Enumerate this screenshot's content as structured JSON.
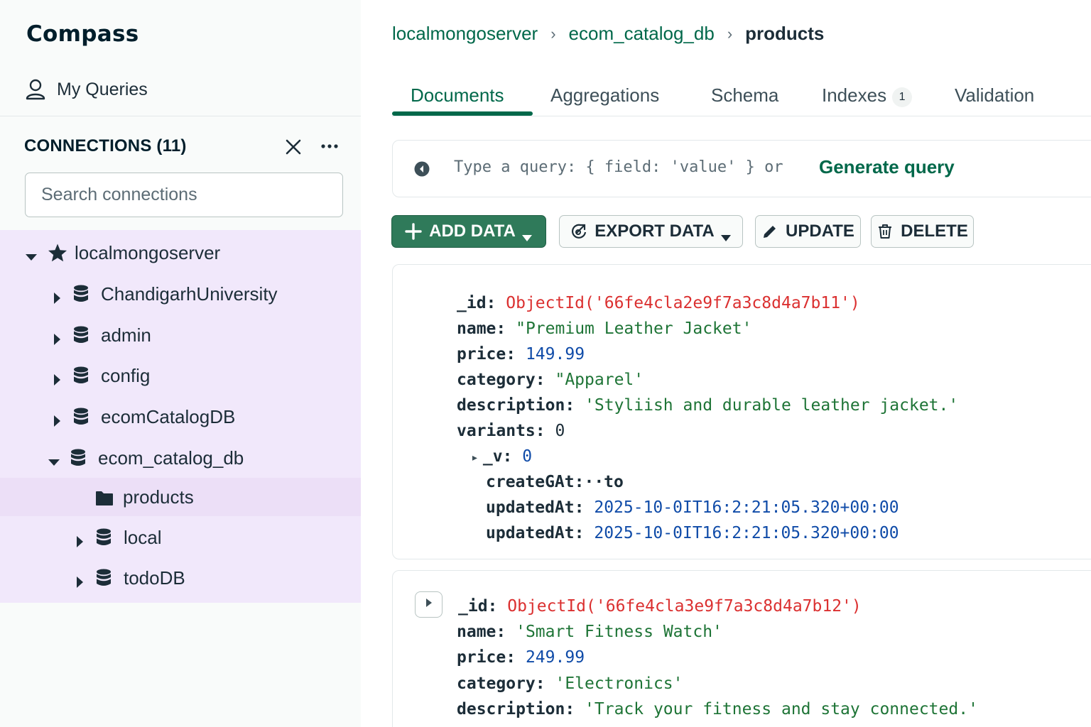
{
  "app": {
    "title": "Compass"
  },
  "sidebar": {
    "my_queries": "My Queries",
    "connections_header": "CONNECTIONS (11)",
    "search_placeholder": "Search connections",
    "tree": {
      "server": "localmongoserver",
      "databases": [
        {
          "name": "ChandigarhUniversity"
        },
        {
          "name": "admin"
        },
        {
          "name": "config"
        },
        {
          "name": "ecomCatalogDB"
        },
        {
          "name": "ecom_catalog_db"
        },
        {
          "name": "local"
        },
        {
          "name": "todoDB"
        }
      ],
      "collections": [
        {
          "name": "products"
        }
      ]
    }
  },
  "breadcrumb": {
    "server": "localmongoserver",
    "database": "ecom_catalog_db",
    "collection": "products"
  },
  "tabs": [
    {
      "label": "Documents"
    },
    {
      "label": "Aggregations"
    },
    {
      "label": "Schema"
    },
    {
      "label": "Indexes",
      "badge": "1"
    },
    {
      "label": "Validation"
    }
  ],
  "query": {
    "placeholder": "Type a query: { field: 'value' } or",
    "generate_label": "Generate query"
  },
  "toolbar": {
    "add_data": "ADD DATA",
    "export_data": "EXPORT DATA",
    "update": "UPDATE",
    "delete": "DELETE"
  },
  "documents": [
    {
      "fields": [
        {
          "key": "_id:",
          "value": "ObjectId('66fe4cla2e9f7a3c8d4a7b11')"
        },
        {
          "key": "name:",
          "value": "\"Premium Leather Jacket'"
        },
        {
          "key": "price:",
          "value": "149.99"
        },
        {
          "key": "category:",
          "value": "\"Apparel'"
        },
        {
          "key": "description:",
          "value": "'Styliish and durable leather jacket.'"
        },
        {
          "key": "variants:",
          "value": "0"
        },
        {
          "key": "_v:",
          "value": "0"
        },
        {
          "key": "createGAt:",
          "value": "··to"
        },
        {
          "key": "updatedAt:",
          "value": "2025-10-0IT16:2:21:05.320+00:00"
        },
        {
          "key": "updatedAt:",
          "value": "2025-10-0IT16:2:21:05.320+00:00"
        }
      ]
    },
    {
      "fields": [
        {
          "key": "_id:",
          "value": "ObjectId('66fe4cla3e9f7a3c8d4a7b12')"
        },
        {
          "key": "name:",
          "value": "'Smart Fitness Watch'"
        },
        {
          "key": "price:",
          "value": "249.99"
        },
        {
          "key": "category:",
          "value": "'Electronics'"
        },
        {
          "key": "description:",
          "value": "'Track your fitness and stay connected.'"
        }
      ]
    }
  ],
  "colors": {
    "accent_green": "#00684a",
    "primary_button": "#2f7a5a",
    "tree_highlight": "#f1e8fb",
    "objectid_red": "#db3030",
    "string_green": "#1e7436",
    "number_blue": "#0f4ba8"
  },
  "icons": {
    "user": "user-icon",
    "close": "close-icon",
    "more": "ellipsis-icon",
    "star": "star-icon",
    "database": "database-icon",
    "folder": "folder-icon",
    "caret_right": "caret-right-icon",
    "caret_down": "caret-down-icon",
    "query": "query-history-icon",
    "plus": "plus-icon",
    "export": "export-icon",
    "pencil": "pencil-icon",
    "trash": "trash-icon"
  }
}
